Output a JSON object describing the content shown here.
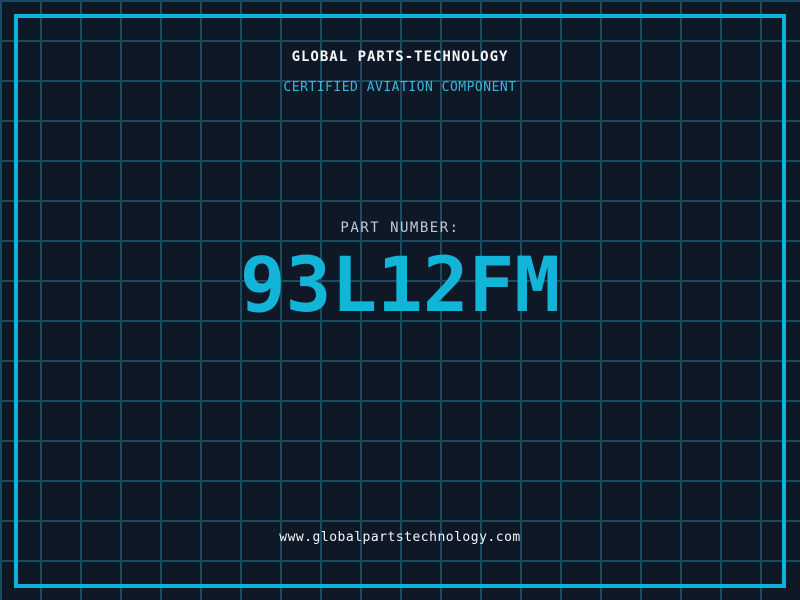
{
  "company": {
    "name": "GLOBAL PARTS-TECHNOLOGY",
    "tagline": "CERTIFIED AVIATION COMPONENT",
    "website": "www.globalpartstechnology.com"
  },
  "part": {
    "label": "PART NUMBER:",
    "number": "93L12FM"
  },
  "colors": {
    "background": "#0f1826",
    "grid_line": "#1d4a5f",
    "frame_border": "#0cb4d8",
    "part_number_cyan": "#12b4d8",
    "tagline_cyan": "#38b8dc",
    "heading_white": "#f5f7fa",
    "label_gray": "#c2c9d2"
  }
}
